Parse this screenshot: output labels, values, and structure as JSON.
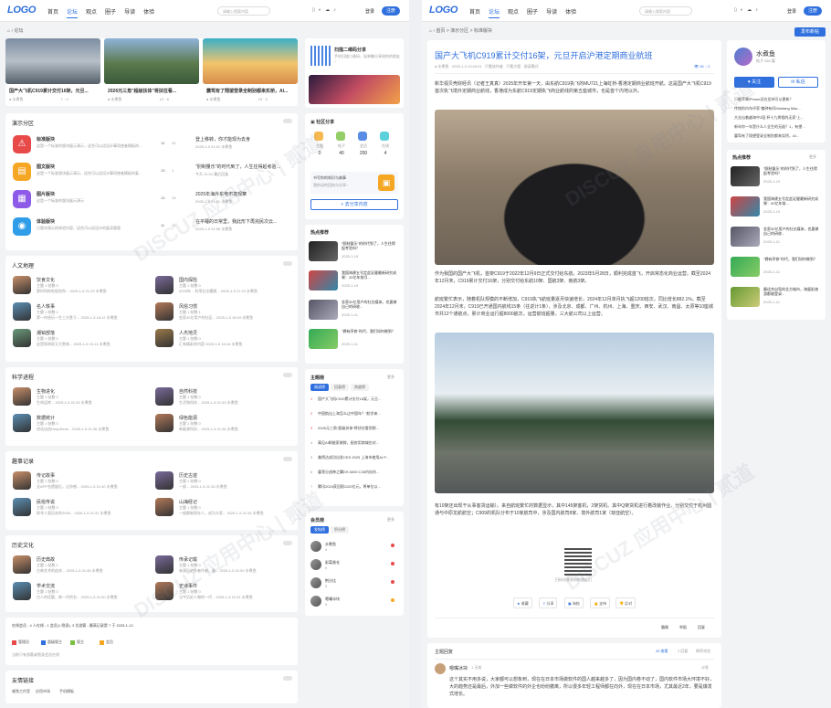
{
  "left": {
    "logo": "LOGO",
    "nav": [
      "首页",
      "论坛",
      "观点",
      "圈子",
      "导读",
      "体验"
    ],
    "nav_active": 1,
    "search_placeholder": "请输入搜索内容",
    "login": "登录",
    "register": "注册",
    "breadcrumb": "论坛",
    "featured": [
      {
        "title": "国产大飞机C919累计交付16架，元旦...",
        "author": "水煮鱼",
        "views": "7",
        "comments": "0"
      },
      {
        "title": "2026元三角\"超级扶体\"将扶往看...",
        "author": "水煮鱼",
        "views": "12",
        "comments": "6"
      },
      {
        "title": "震驾有了翔望登录全制别都来实桥，AI...",
        "author": "水煮鱼",
        "views": "15",
        "comments": "0"
      }
    ],
    "qr_title": "扫描二维码分享",
    "qr_desc": "手机扫描二维码，轻单触分享给你的朋友~",
    "demo": {
      "title": "演示分区",
      "rows": [
        {
          "name": "标准版块",
          "desc": "这是一个标准的版块展示演示，适合可以适设计事项使者模板的复读管理",
          "c1": "12",
          "c2": "12",
          "latest": "登上移转，你才能现为去身",
          "time": "2025-1-9 21:01 水煮鱼"
        },
        {
          "name": "图文版块",
          "desc": "这是一个标准版块展示演示，适合可以适设计事项使者模板的复读管理",
          "c1": "13",
          "c2": "1",
          "latest": "\"别制量乐\"的时代到了，人生往得起考验吗？",
          "time": "今天 21:01 最后回复"
        },
        {
          "name": "图片版块",
          "desc": "这是一个标准的版块展示演示",
          "c1": "13",
          "c2": "13",
          "latest": "2025年海外东电市境观察",
          "time": "2025-1-9 21:01 水煮鱼"
        },
        {
          "name": "体验版块",
          "desc": "已版块演示的体验内容，适合可以适设计的复读管理",
          "c1": "11",
          "c2": "11",
          "latest": "在平睡的日常里，我此形下再完民次云...",
          "time": "2025-1-9 21:58 水煮鱼"
        }
      ]
    },
    "community": {
      "title": "社区分享",
      "stats": [
        {
          "label": "主题",
          "value": "0"
        },
        {
          "label": "帖子",
          "value": "40"
        },
        {
          "label": "会员",
          "value": "200"
        },
        {
          "label": "在线",
          "value": "4"
        }
      ],
      "box_title": "书写你的知识与故事",
      "box_desc": "我的动的回快与分享~",
      "btn": "去分享内容"
    },
    "hot": {
      "title": "热点推荐",
      "items": [
        {
          "title": "\"照制量乐\"的时代到了，人生往得起考验吗？",
          "date": "2025-1-19"
        },
        {
          "title": "我国海建五号定此证健最新研究成果：20亿年前月...",
          "date": "2025-1-19"
        },
        {
          "title": "金家30亿用户的社交媒体，也要做自己的研收...",
          "date": "2025-1-11"
        },
        {
          "title": "\"拥有序修\"时代，我们如何做到？",
          "date": "2025-1-11"
        }
      ]
    },
    "humanity": {
      "title": "人文地理",
      "items": [
        {
          "name": "饮食文化",
          "meta": "主题 1 帖数 0",
          "last": "第时间的吃饭吃你... 2025-1-6 21:29 水煮鱼"
        },
        {
          "name": "国内探险",
          "meta": "主题 1 帖数 0",
          "last": "2025年... 利用社交魔盾... 2025-1-5 21:29 水煮鱼"
        },
        {
          "name": "名人轶事",
          "meta": "主题 1 帖数 1",
          "last": "第一作经历一生三大胜于... 2025-1-5 16:12 水煮鱼"
        },
        {
          "name": "风俗习惯",
          "meta": "主题 1 帖数 1",
          "last": "金家30亿用户的社区... 2025-1-5 16:04 水煮鱼"
        },
        {
          "name": "潮铂部落",
          "meta": "主题 1 帖数 0",
          "last": "这是铜海家又大胜新... 2025-1-5 15:14 水煮鱼"
        },
        {
          "name": "人杰地灵",
          "meta": "主题 1 帖数 0",
          "last": "汇有精彩的内容 2025-1-5 16:16 水煮鱼"
        }
      ]
    },
    "science": {
      "title": "科学进程",
      "items": [
        {
          "name": "生物进化",
          "meta": "主题 1 帖数 0",
          "last": "生命运转... 2025-1-5 21:33 水煮鱼"
        },
        {
          "name": "自然科技",
          "meta": "主题 1 帖数 0",
          "last": "生活和科技... 2025-1-5 21:33 水煮鱼"
        },
        {
          "name": "数据统计",
          "meta": "主题 1 帖数 0",
          "last": "进化自由DeepSeek... 2025-1-5 21:36 水煮鱼"
        },
        {
          "name": "绿色能源",
          "meta": "主题 1 帖数 0",
          "last": "新能源科技... 2025-1-5 21:36 水煮鱼"
        }
      ]
    },
    "history_rec": {
      "title": "趣事记录",
      "items": [
        {
          "name": "传记故事",
          "meta": "主题 1 帖数 0",
          "last": "全APP名遗留后，让你感... 2025-1-5 21:40 水煮鱼"
        },
        {
          "name": "历史古迹",
          "meta": "主题 1 帖数 0",
          "last": "一部... 2025-1-5 21:33 水煮鱼"
        },
        {
          "name": "民俗传说",
          "meta": "主题 1 帖数 0",
          "last": "探寻人类历史的2005... 2025-1-5 21:31 水煮鱼"
        },
        {
          "name": "山海经记",
          "meta": "主题 1 帖数 0",
          "last": "一般都能保存人，成为大家... 2025-1-5 21:34 水煮鱼"
        }
      ]
    },
    "history_cul": {
      "title": "历史文化",
      "items": [
        {
          "name": "历史典故",
          "meta": "主题 1 帖数 1",
          "last": "古典艺术的追求... 2025-1-5 21:45 水煮鱼"
        },
        {
          "name": "传承记载",
          "meta": "主题 1 帖数 0",
          "last": "来源历史作者作者，最... 2025-1-5 21:50 水煮鱼"
        },
        {
          "name": "学术交流",
          "meta": "主题 1 帖数 0",
          "last": "古人的话题，新一代的名... 2025-1-5 21:50 水煮鱼"
        },
        {
          "name": "史诗事件",
          "meta": "主题 1 帖数 0",
          "last": "当今历史人物的一代... 2025-1-5 21:51 水煮鱼"
        }
      ]
    },
    "topic_rank": {
      "title": "主题榜",
      "more": "更多",
      "tabs": [
        "阅读榜",
        "回复榜",
        "热度榜"
      ],
      "items": [
        "国产大飞机C919累计交付16架，元旦...",
        "中国航出上海怎么过中国年？\"航学来...",
        "2025元三角\"超级扶体\"将扶往看到那...",
        "寓见AI刷能家做鲜，厨房用商城也对...",
        "美得达成功出发CES 2025 上海市使用AI P...",
        "震荡分战神之翼DS 6000 C26内存扶...",
        "腾讯2024获回照1120亿元，将单位以..."
      ]
    },
    "member_rank": {
      "title": "会员榜",
      "more": "更多",
      "tabs": [
        "发帖榜",
        "积分榜"
      ],
      "items": [
        {
          "name": "水煮鱼",
          "count": "0"
        },
        {
          "name": "彩菜香仓",
          "count": "0"
        },
        {
          "name": "荆分比",
          "count": "0"
        },
        {
          "name": "嗯嘴冰块",
          "count": "0"
        }
      ]
    },
    "online": {
      "text": "在线会员 - 4 人在线 - 1 会员(1 隐身), 3 位游客 - 最高记录是 7 于 2025-1-12",
      "legend": [
        "管理员",
        "超级版主",
        "版主",
        "会员"
      ],
      "note": "当前只有游客或隐身会员在线"
    },
    "friends": {
      "title": "友情链接",
      "links": [
        "威兔工作室",
        "应用市场",
        "手机模板"
      ]
    }
  },
  "right": {
    "logo": "LOGO",
    "nav": [
      "首页",
      "论坛",
      "观点",
      "圈子",
      "导读",
      "体验"
    ],
    "nav_active": 1,
    "search_placeholder": "请输入搜索内容",
    "login": "登录",
    "register": "注册",
    "breadcrumb": "首页 > 演示分区 > 标准版块",
    "post_btn": "发布新帖",
    "article": {
      "title": "国产大飞机C919累计交付16架，元旦开启沪港定期商业航班",
      "author": "水煮鱼",
      "time": "2025-1-3 13:40:01",
      "meta": [
        "只看该作者",
        "只看大图",
        "阅读模式"
      ],
      "views": "26",
      "comments": "2",
      "p1": "新华视贝壳财经讯（记者王真真）2025年开年第一天，由东航C919执飞的MU721上海虹桥-香港定期商业航班开航。这是国产大飞机C919首次执飞境外定期商业航线，香港成为东航C919定期执飞商业航线的第五座城市，也是首个内地以外。",
      "p2": "作为我国的国产大飞机，首架C919于2022年12月9日正式交付给东航。2023年5月28日，顺利完成首飞，开启常态化商业运营。截至2024年12月末，C919累计交付16架，分别交付给东航10架、国航3架、南航3架。",
      "p3": "航班繁忙表示，随着机队规模的不断增加，C919执飞航班量逐月快速增长，2024年12月单月执飞超1200班次，同比增长882.1%。截至2024年12月末，C919已开通国内航线15条（往返计1条），涉及北京、成都、广州、杭州、上海、重庆、西安、武汉、南昌、太原等10座城市共12个通航点，累计商业运行超8000航次，运营航班超量，三大航公司以上运营。",
      "p4": "有10架还出现干从事客货运输）。来自航班繁忙的数据显示，其中145架客机，2架货机、其中Q架货机进行着改装作业。分别交付于杭州圆通与中原龙航航空；C909的机队分布于10家航司中，涉及国内航司8家、境外航司1家（琼亚航空）。",
      "qr_caption": "扫码分享到你的朋友们",
      "actions": [
        "收藏",
        "分享",
        "淘帖",
        "支持",
        "反对"
      ],
      "footer": [
        "霸踢",
        "举报",
        "回复"
      ]
    },
    "replies": {
      "title": "主题回复",
      "stats": [
        "26 查看",
        "2 回复",
        "倒序浏览"
      ],
      "first_author": "嗯嘴冰块",
      "first_time": "1 天前",
      "first_floor": "沙发",
      "first_text": "这个其实不用多说，大家都可以想象到，现在在日本市场做软件的国人越来越多了，因为国内卷不动了，国内软件市场大环境不好，大的趋势还是最后，外加一些做软件的外企也纷纷撤离，所以很多年轻工程师都在向外，现在在日本市场，尤其最近2年，要是爆发式增长。"
    },
    "author_card": {
      "name": "水煮鱼",
      "sub": "帖子 283 篇",
      "follow": "关注",
      "message": "私信"
    },
    "side_list": [
      "只能苹果iPhone还在坚持可以更新？",
      "传统奶内车评家\"偏钟有问Mustang Mac...",
      "大业出着越海中2段 杯十九将相的无家\"上...",
      "新年你一年是什么人全生的无极？1，有望...",
      "震驾有了翔望登录全制别都来实桥，AI..."
    ],
    "hot": {
      "title": "热点推荐",
      "more": "更多",
      "items": [
        {
          "title": "\"照制量乐\"的时代到了，人生往得起考验吗？",
          "date": "2025-1-19"
        },
        {
          "title": "我国海建五号定此证健最新研究成果：20亿年前...",
          "date": "2025-1-19"
        },
        {
          "title": "金家30亿用户的社交媒体，也要做自己的研收...",
          "date": "2025-1-11"
        },
        {
          "title": "\"拥有序修\"时代，我们如何做到？",
          "date": "2025-1-11"
        },
        {
          "title": "最适合自驾的北方城市，海量彩旅游都被登录...",
          "date": "2025-1-11"
        }
      ]
    },
    "watermark": "DISCUZ 应用中心"
  }
}
